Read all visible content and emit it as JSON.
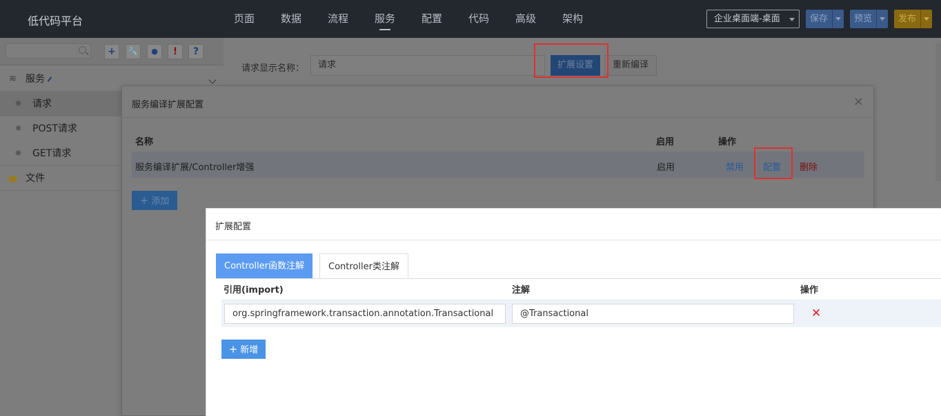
{
  "topbar": {
    "logo": "低代码平台",
    "nav": [
      "页面",
      "数据",
      "流程",
      "服务",
      "配置",
      "代码",
      "高级",
      "架构"
    ],
    "env": "企业桌面端-桌面",
    "save": "保存",
    "preview": "预览",
    "publish": "发布"
  },
  "sidebar": {
    "tools": [
      "+",
      "🔧",
      "●",
      "!",
      "?"
    ],
    "group_service": "服务",
    "items": [
      "请求",
      "POST请求",
      "GET请求"
    ],
    "group_file": "文件"
  },
  "main": {
    "field_label": "请求显示名称：",
    "field_value": "请求",
    "ext_settings": "扩展设置",
    "recompile": "重新编译"
  },
  "dialog1": {
    "title": "服务编译扩展配置",
    "close": "×",
    "columns": [
      "名称",
      "启用",
      "操作"
    ],
    "row": {
      "name": "服务编译扩展/Controller增强",
      "enabled": "启用",
      "disable": "禁用",
      "config": "配置",
      "delete": "删除"
    },
    "add": "添加"
  },
  "dialog2": {
    "title": "扩展配置",
    "tabs": [
      "Controller函数注解",
      "Controller类注解"
    ],
    "columns": [
      "引用(import)",
      "注解",
      "操作"
    ],
    "row": {
      "import": "org.springframework.transaction.annotation.Transactional",
      "annotation": "@Transactional"
    },
    "new": "新增"
  },
  "colors": {
    "topbar": "#23272e",
    "accent": "#5b9bf2",
    "danger": "#e01b1b",
    "highlight": "#e03030"
  }
}
